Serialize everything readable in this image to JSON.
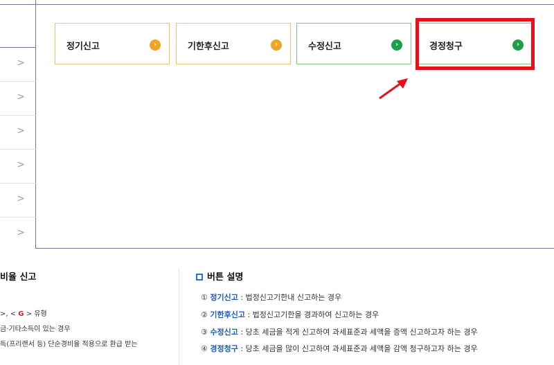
{
  "cards": [
    {
      "label": "정기신고",
      "arrow": "›"
    },
    {
      "label": "기한후신고",
      "arrow": "›"
    },
    {
      "label": "수정신고",
      "arrow": "›"
    },
    {
      "label": "경정청구",
      "arrow": "›"
    }
  ],
  "left_rows": [
    ">",
    ">",
    ">",
    ">",
    ">",
    ">"
  ],
  "left_section": {
    "title": "비율 신고",
    "line1_prefix": ">, < ",
    "line1_g": "G",
    "line1_suffix": " > 유형",
    "line2": "금·기타소득이 있는 경우",
    "line3": "득(프리랜서 등) 단순경비율 적용으로 환급 받는"
  },
  "button_section": {
    "title": "버튼 설명",
    "items": [
      {
        "num": "①",
        "kw": "정기신고",
        "text": " : 법정신고기한내 신고하는 경우"
      },
      {
        "num": "②",
        "kw": "기한후신고",
        "text": " : 법정신고기한을 경과하여 신고하는 경우"
      },
      {
        "num": "③",
        "kw": "수정신고",
        "text": " : 당초 세금을 적게 신고하여 과세표준과 세액을 증액 신고하고자 하는 경우"
      },
      {
        "num": "④",
        "kw": "경정청구",
        "text": " : 당초 세금을 많이 신고하여 과세표준과 세액을 감액 청구하고자 하는 경우"
      }
    ]
  },
  "colors": {
    "highlight": "#e8101a",
    "orange": "#f2a321",
    "green": "#1e9e4a",
    "keyword": "#1e5bb8"
  }
}
